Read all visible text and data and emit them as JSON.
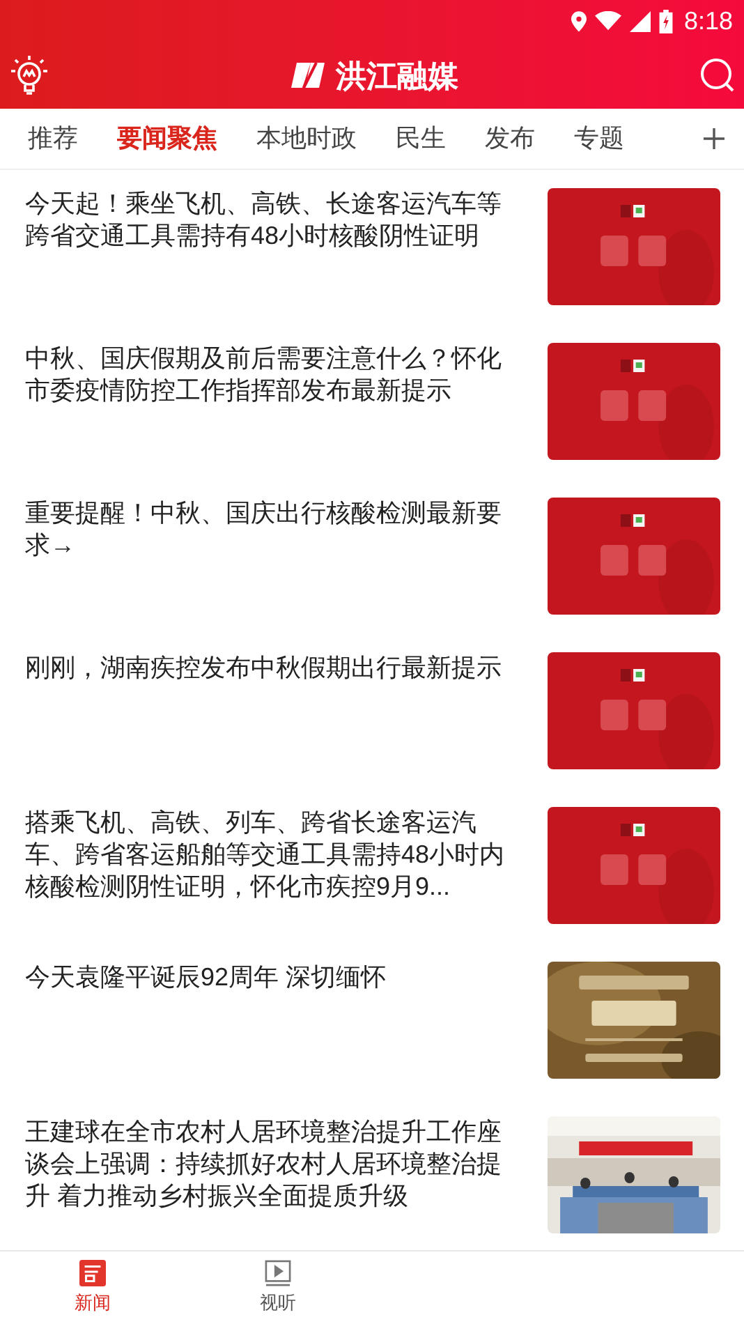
{
  "status_bar": {
    "time": "8:18"
  },
  "header": {
    "title": "洪江融媒"
  },
  "tabs": [
    {
      "label": "推荐",
      "selected": false
    },
    {
      "label": "要闻聚焦",
      "selected": true
    },
    {
      "label": "本地时政",
      "selected": false
    },
    {
      "label": "民生",
      "selected": false
    },
    {
      "label": "发布",
      "selected": false
    },
    {
      "label": "专题",
      "selected": false
    }
  ],
  "articles": [
    {
      "title": "今天起！乘坐飞机、高铁、长途客运汽车等跨省交通工具需持有48小时核酸阴性证明"
    },
    {
      "title": "中秋、国庆假期及前后需要注意什么？怀化市委疫情防控工作指挥部发布最新提示"
    },
    {
      "title": "重要提醒！中秋、国庆出行核酸检测最新要求→"
    },
    {
      "title": "刚刚，湖南疾控发布中秋假期出行最新提示"
    },
    {
      "title": "搭乘飞机、高铁、列车、跨省长途客运汽车、跨省客运船舶等交通工具需持48小时内核酸检测阴性证明，怀化市疾控9月9..."
    },
    {
      "title": "今天袁隆平诞辰92周年 深切缅怀"
    },
    {
      "title": "王建球在全市农村人居环境整治提升工作座谈会上强调：持续抓好农村人居环境整治提升 着力推动乡村振兴全面提质升级"
    }
  ],
  "bottom_nav": [
    {
      "label": "新闻",
      "selected": true
    },
    {
      "label": "视听",
      "selected": false
    }
  ]
}
